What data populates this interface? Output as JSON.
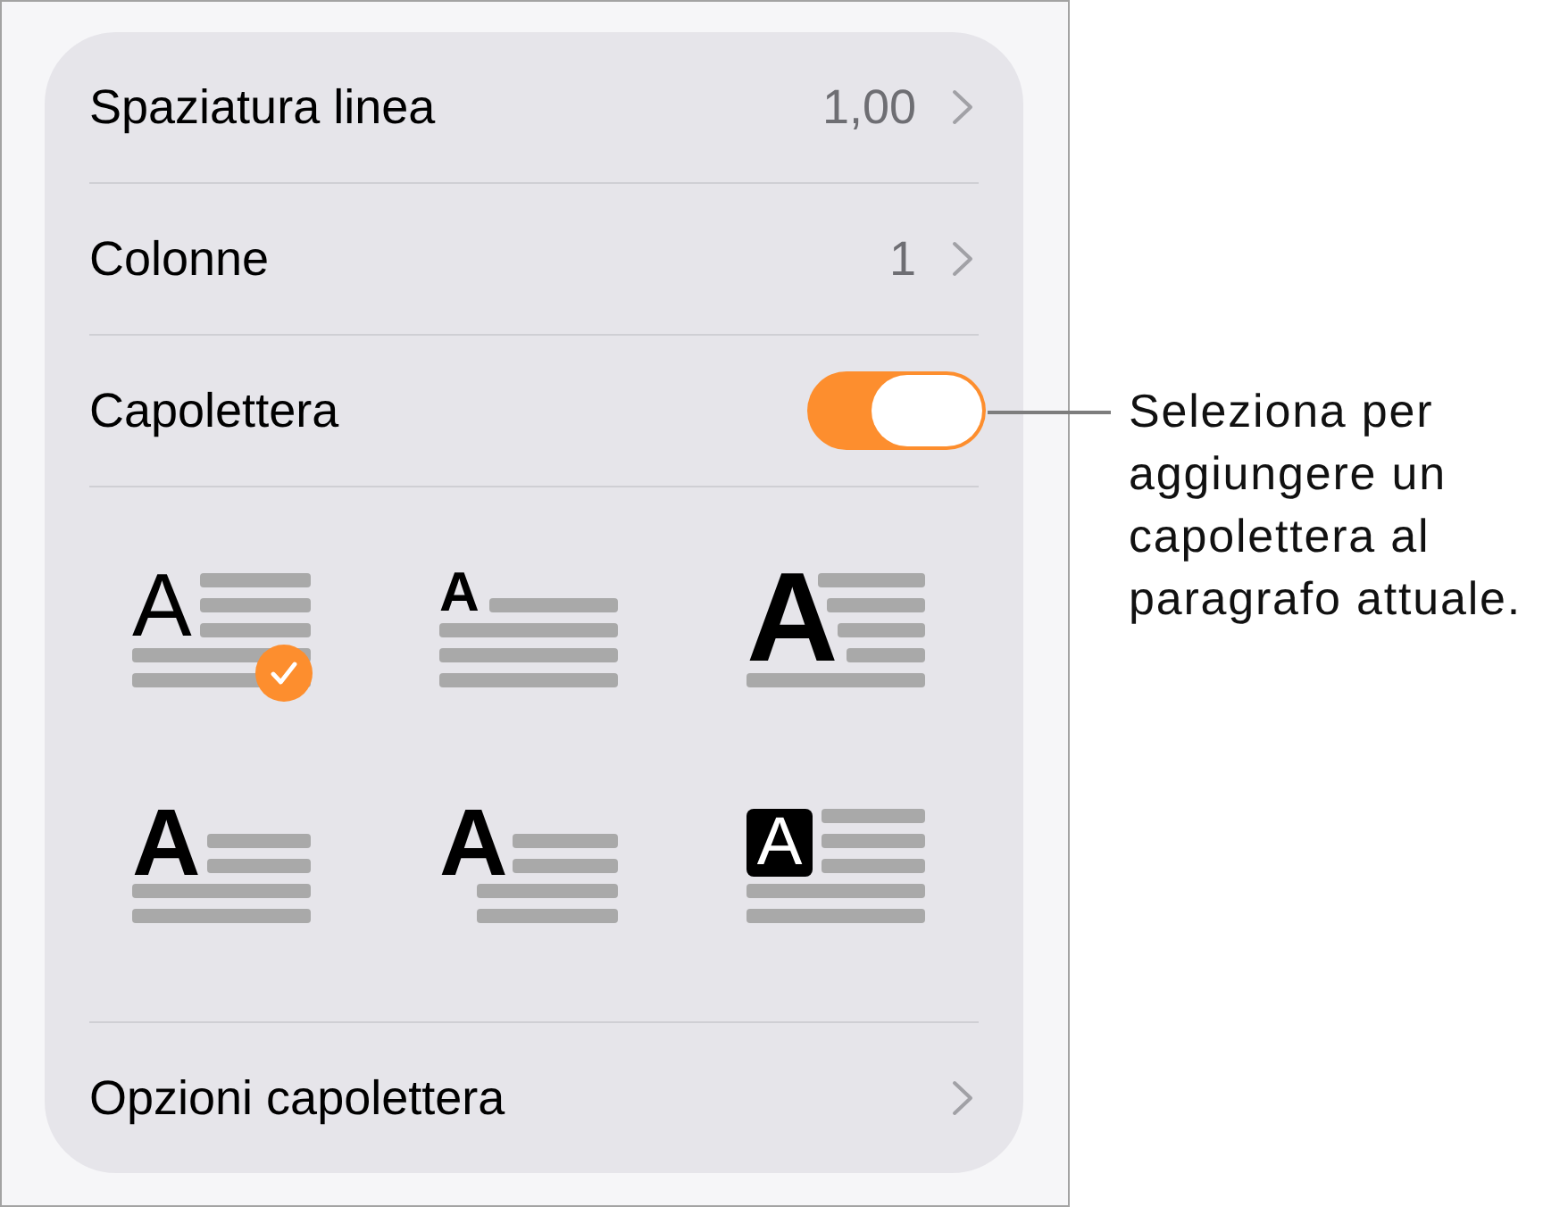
{
  "settings": [
    {
      "kind": "disclosure",
      "label": "Spaziatura linea",
      "value": "1,00"
    },
    {
      "kind": "disclosure",
      "label": "Colonne",
      "value": "1"
    },
    {
      "kind": "toggle",
      "label": "Capolettera",
      "on": true
    }
  ],
  "drop_cap_styles": [
    {
      "kind": "light",
      "letter": "A",
      "selected": true
    },
    {
      "kind": "small",
      "letter": "A",
      "selected": false
    },
    {
      "kind": "large",
      "letter": "A",
      "selected": false
    },
    {
      "kind": "bold",
      "letter": "A",
      "selected": false
    },
    {
      "kind": "hanging",
      "letter": "A",
      "selected": false
    },
    {
      "kind": "boxed",
      "letter": "A",
      "selected": false
    }
  ],
  "options_row": {
    "label": "Opzioni capolettera"
  },
  "callout": {
    "text": "Seleziona per aggiungere un capolettera al paragrafo attuale."
  }
}
